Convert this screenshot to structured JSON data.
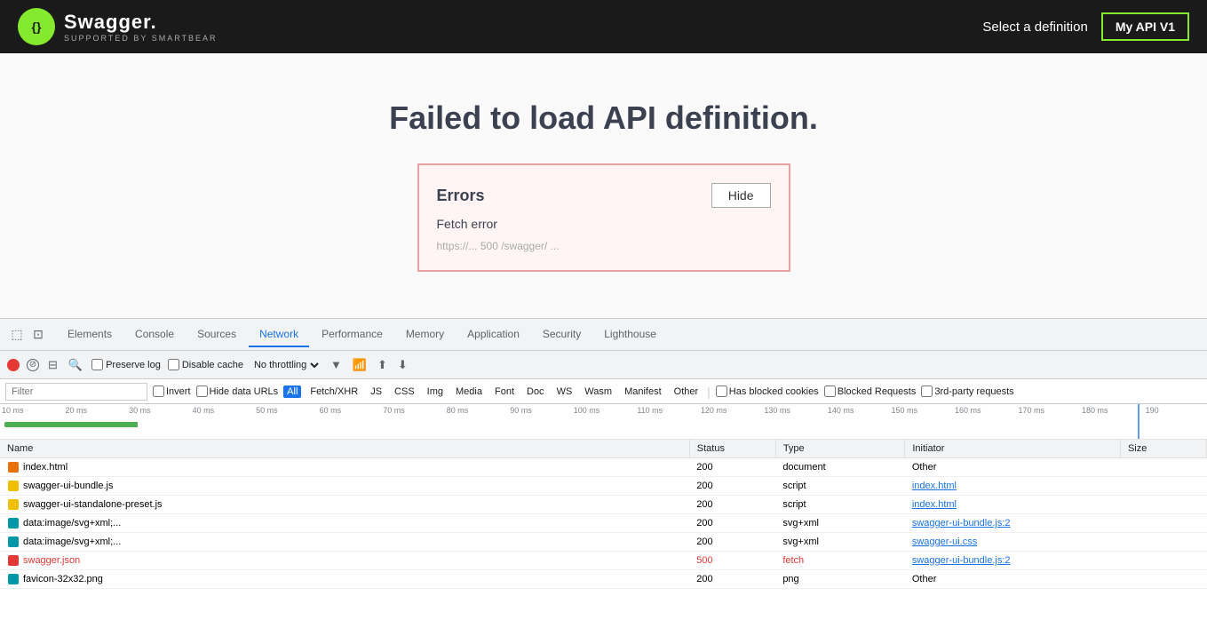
{
  "topbar": {
    "logo_icon": "⬡",
    "logo_title": "Swagger.",
    "logo_subtitle": "Supported by SMARTBEAR",
    "select_definition_label": "Select a definition",
    "api_version": "My API V1"
  },
  "main": {
    "error_heading": "Failed to load API definition.",
    "error_box": {
      "title": "Errors",
      "hide_button": "Hide",
      "fetch_error": "Fetch error",
      "fetch_detail": "https://... 500 /swagger/ ..."
    }
  },
  "devtools": {
    "tabs": [
      {
        "label": "Elements",
        "active": false
      },
      {
        "label": "Console",
        "active": false
      },
      {
        "label": "Sources",
        "active": false
      },
      {
        "label": "Network",
        "active": true
      },
      {
        "label": "Performance",
        "active": false
      },
      {
        "label": "Memory",
        "active": false
      },
      {
        "label": "Application",
        "active": false
      },
      {
        "label": "Security",
        "active": false
      },
      {
        "label": "Lighthouse",
        "active": false
      }
    ],
    "toolbar": {
      "preserve_log": "Preserve log",
      "disable_cache": "Disable cache",
      "throttle_value": "No throttling"
    },
    "filter_row": {
      "placeholder": "Filter",
      "invert": "Invert",
      "hide_data_urls": "Hide data URLs",
      "all_active": true,
      "types": [
        "All",
        "Fetch/XHR",
        "JS",
        "CSS",
        "Img",
        "Media",
        "Font",
        "Doc",
        "WS",
        "Wasm",
        "Manifest",
        "Other"
      ],
      "has_blocked_cookies": "Has blocked cookies",
      "blocked_requests": "Blocked Requests",
      "third_party": "3rd-party requests"
    },
    "timeline": {
      "labels": [
        "10 ms",
        "20 ms",
        "30 ms",
        "40 ms",
        "50 ms",
        "60 ms",
        "70 ms",
        "80 ms",
        "90 ms",
        "100 ms",
        "110 ms",
        "120 ms",
        "130 ms",
        "140 ms",
        "150 ms",
        "160 ms",
        "170 ms",
        "180 ms",
        "190"
      ]
    },
    "table": {
      "headers": [
        "Name",
        "Status",
        "Type",
        "Initiator",
        "Size"
      ],
      "rows": [
        {
          "icon": "html",
          "name": "index.html",
          "status": "200",
          "type": "document",
          "initiator": "Other",
          "initiator_link": false,
          "error": false
        },
        {
          "icon": "js",
          "name": "swagger-ui-bundle.js",
          "status": "200",
          "type": "script",
          "initiator": "index.html",
          "initiator_link": true,
          "error": false
        },
        {
          "icon": "js",
          "name": "swagger-ui-standalone-preset.js",
          "status": "200",
          "type": "script",
          "initiator": "index.html",
          "initiator_link": true,
          "error": false
        },
        {
          "icon": "img",
          "name": "data:image/svg+xml;...",
          "status": "200",
          "type": "svg+xml",
          "initiator": "swagger-ui-bundle.js:2",
          "initiator_link": true,
          "error": false
        },
        {
          "icon": "img",
          "name": "data:image/svg+xml;...",
          "status": "200",
          "type": "svg+xml",
          "initiator": "swagger-ui.css",
          "initiator_link": true,
          "error": false
        },
        {
          "icon": "json",
          "name": "swagger.json",
          "status": "500",
          "type": "fetch",
          "initiator": "swagger-ui-bundle.js:2",
          "initiator_link": true,
          "error": true
        },
        {
          "icon": "png",
          "name": "favicon-32x32.png",
          "status": "200",
          "type": "png",
          "initiator": "Other",
          "initiator_link": false,
          "error": false
        }
      ]
    }
  }
}
